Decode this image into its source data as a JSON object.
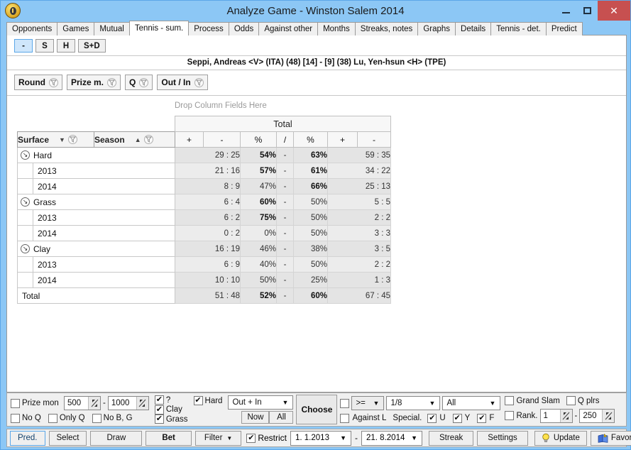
{
  "window": {
    "title": "Analyze Game - Winston Salem 2014",
    "app_icon": "coin-icon",
    "minimize": "minimize-icon",
    "maximize": "maximize-icon",
    "close": "close-icon"
  },
  "tabs": [
    {
      "label": "Opponents",
      "active": false
    },
    {
      "label": "Games",
      "active": false
    },
    {
      "label": "Mutual",
      "active": false
    },
    {
      "label": "Tennis - sum.",
      "active": true
    },
    {
      "label": "Process",
      "active": false
    },
    {
      "label": "Odds",
      "active": false
    },
    {
      "label": "Against other",
      "active": false
    },
    {
      "label": "Months",
      "active": false
    },
    {
      "label": "Streaks, notes",
      "active": false
    },
    {
      "label": "Graphs",
      "active": false
    },
    {
      "label": "Details",
      "active": false
    },
    {
      "label": "Tennis - det.",
      "active": false
    },
    {
      "label": "Predict",
      "active": false
    }
  ],
  "mode_buttons": [
    {
      "label": "-",
      "selected": true
    },
    {
      "label": "S",
      "selected": false
    },
    {
      "label": "H",
      "selected": false
    },
    {
      "label": "S+D",
      "selected": false
    }
  ],
  "match_header": "Seppi, Andreas <V> (ITA) (48) [14] - [9] (38) Lu, Yen-hsun <H> (TPE)",
  "filter_fields": [
    {
      "label": "Round"
    },
    {
      "label": "Prize m."
    },
    {
      "label": "Q"
    },
    {
      "label": "Out / In"
    }
  ],
  "pivot": {
    "drop_column_hint": "Drop Column Fields Here",
    "row_fields": [
      {
        "label": "Surface",
        "sort": "desc"
      },
      {
        "label": "Season",
        "sort": "asc"
      }
    ],
    "column_group": "Total",
    "column_headers": [
      "+",
      "-",
      "%",
      "/",
      "%",
      "+",
      "-"
    ],
    "rows": [
      {
        "label": "Hard",
        "level": 1,
        "expandable": true,
        "cells": [
          "29 : 25",
          "54%",
          "-",
          "63%",
          "59 : 35"
        ],
        "bold_pct1": true,
        "bold_pct2": true
      },
      {
        "label": "2013",
        "level": 2,
        "expandable": false,
        "cells": [
          "21 : 16",
          "57%",
          "-",
          "61%",
          "34 : 22"
        ],
        "bold_pct1": true,
        "bold_pct2": true
      },
      {
        "label": "2014",
        "level": 2,
        "expandable": false,
        "cells": [
          "8 : 9",
          "47%",
          "-",
          "66%",
          "25 : 13"
        ],
        "bold_pct1": false,
        "bold_pct2": true
      },
      {
        "label": "Grass",
        "level": 1,
        "expandable": true,
        "cells": [
          "6 : 4",
          "60%",
          "-",
          "50%",
          "5 : 5"
        ],
        "bold_pct1": true,
        "bold_pct2": false
      },
      {
        "label": "2013",
        "level": 2,
        "expandable": false,
        "cells": [
          "6 : 2",
          "75%",
          "-",
          "50%",
          "2 : 2"
        ],
        "bold_pct1": true,
        "bold_pct2": false
      },
      {
        "label": "2014",
        "level": 2,
        "expandable": false,
        "cells": [
          "0 : 2",
          "0%",
          "-",
          "50%",
          "3 : 3"
        ],
        "bold_pct1": false,
        "bold_pct2": false
      },
      {
        "label": "Clay",
        "level": 1,
        "expandable": true,
        "cells": [
          "16 : 19",
          "46%",
          "-",
          "38%",
          "3 : 5"
        ],
        "bold_pct1": false,
        "bold_pct2": false
      },
      {
        "label": "2013",
        "level": 2,
        "expandable": false,
        "cells": [
          "6 : 9",
          "40%",
          "-",
          "50%",
          "2 : 2"
        ],
        "bold_pct1": false,
        "bold_pct2": false
      },
      {
        "label": "2014",
        "level": 2,
        "expandable": false,
        "cells": [
          "10 : 10",
          "50%",
          "-",
          "25%",
          "1 : 3"
        ],
        "bold_pct1": false,
        "bold_pct2": false
      },
      {
        "label": "Total",
        "level": 0,
        "expandable": false,
        "cells": [
          "51 : 48",
          "52%",
          "-",
          "60%",
          "67 : 45"
        ],
        "bold_pct1": true,
        "bold_pct2": true
      }
    ]
  },
  "options": {
    "prize_money_label": "Prize mon",
    "prize_money_checked": false,
    "prize_min": "500",
    "prize_max": "1000",
    "range_dash": "-",
    "no_q_label": "No Q",
    "no_q_checked": false,
    "only_q_label": "Only Q",
    "only_q_checked": false,
    "no_bg_label": "No B, G",
    "no_bg_checked": false,
    "surface_unknown_label": "?",
    "surface_unknown_checked": true,
    "surface_clay_label": "Clay",
    "surface_clay_checked": true,
    "surface_grass_label": "Grass",
    "surface_grass_checked": true,
    "surface_hard_label": "Hard",
    "surface_hard_checked": true,
    "venue_select": "Out + In",
    "now_label": "Now",
    "all_label": "All",
    "choose_label": "Choose",
    "compare_checked": false,
    "compare_op": ">=",
    "round_select": "1/8",
    "tournament_select": "All",
    "against_l_checked": false,
    "against_l_label": "Against L",
    "special_label": "Special.",
    "special_u_label": "U",
    "special_u_checked": true,
    "special_y_label": "Y",
    "special_y_checked": true,
    "special_f_label": "F",
    "special_f_checked": true,
    "grand_slam_label": "Grand Slam",
    "grand_slam_checked": false,
    "q_plrs_label": "Q plrs",
    "q_plrs_checked": false,
    "rank_label": "Rank.",
    "rank_checked": false,
    "rank_min": "1",
    "rank_max": "250"
  },
  "bottombar": {
    "pred_label": "Pred.",
    "select_label": "Select",
    "draw_label": "Draw",
    "bet_label": "Bet",
    "filter_label": "Filter",
    "restrict_label": "Restrict",
    "restrict_checked": true,
    "date_from": "1.  1.2013",
    "date_to": "21.  8.2014",
    "date_dash": "-",
    "streak_label": "Streak",
    "settings_label": "Settings",
    "update_label": "Update",
    "update_icon": "lightbulb-icon",
    "favorite_label": "Favorite",
    "favorite_icon": "book-icon"
  },
  "colors": {
    "window_frame": "#8cc7f5",
    "close_button": "#c75050",
    "selected_button": "#cfe6fb",
    "value_cell": "#e4e4e4"
  }
}
